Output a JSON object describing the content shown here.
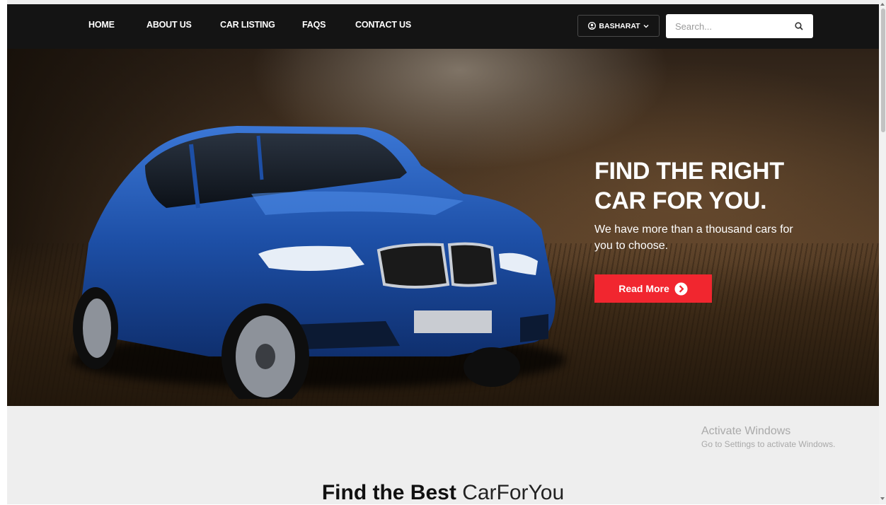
{
  "nav": {
    "links": [
      "HOME",
      "ABOUT US",
      "CAR LISTING",
      "FAQS",
      "CONTACT US"
    ],
    "user_label": "BASHARAT",
    "search_placeholder": "Search..."
  },
  "hero": {
    "title_line1": "FIND THE RIGHT",
    "title_line2": "CAR FOR YOU.",
    "subtitle": "We have more than a thousand cars for you to choose.",
    "button_label": "Read More"
  },
  "watermark": {
    "line1": "Activate Windows",
    "line2": "Go to Settings to activate Windows."
  },
  "section": {
    "title_bold": "Find the Best",
    "title_light": "CarForYou"
  },
  "colors": {
    "accent": "#f1262f",
    "navbar": "#141414",
    "car_blue": "#1d4fa6"
  },
  "icons": {
    "user": "user-circle-icon",
    "caret": "chevron-down-icon",
    "search": "search-icon",
    "button_arrow": "arrow-circle-right-icon"
  }
}
